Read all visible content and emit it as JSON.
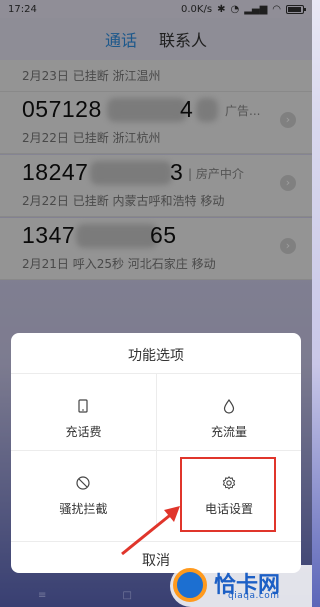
{
  "status_bar": {
    "time": "17:24",
    "network_speed": "0.0K/s",
    "icons": [
      "bluetooth-icon",
      "alarm-icon",
      "signal-icon",
      "wifi-icon",
      "battery-icon"
    ]
  },
  "tabs": [
    {
      "label": "通话",
      "active": true
    },
    {
      "label": "联系人",
      "active": false
    }
  ],
  "calls": [
    {
      "number": "",
      "tag": "",
      "info": "2月23日 已挂断 浙江温州"
    },
    {
      "number": "057128",
      "number_tail": "4",
      "tag": "广告...",
      "info": "2月22日 已挂断 浙江杭州"
    },
    {
      "number": "18247",
      "number_tail": "3",
      "tag": "房产中介",
      "info": "2月22日 已挂断 内蒙古呼和浩特 移动"
    },
    {
      "number": "1347",
      "number_tail": "65",
      "tag": "",
      "info": "2月21日 呼入25秒 河北石家庄 移动"
    }
  ],
  "sheet": {
    "title": "功能选项",
    "options": [
      {
        "label": "充话费",
        "icon": "phone-card-icon"
      },
      {
        "label": "充流量",
        "icon": "data-drop-icon"
      },
      {
        "label": "骚扰拦截",
        "icon": "block-icon"
      },
      {
        "label": "电话设置",
        "icon": "gear-icon"
      }
    ],
    "cancel": "取消"
  },
  "watermark": {
    "text": "恰卡网",
    "url": "qiaqa.com"
  },
  "colors": {
    "accent": "#2f8ee0",
    "highlight": "#e0352b"
  }
}
